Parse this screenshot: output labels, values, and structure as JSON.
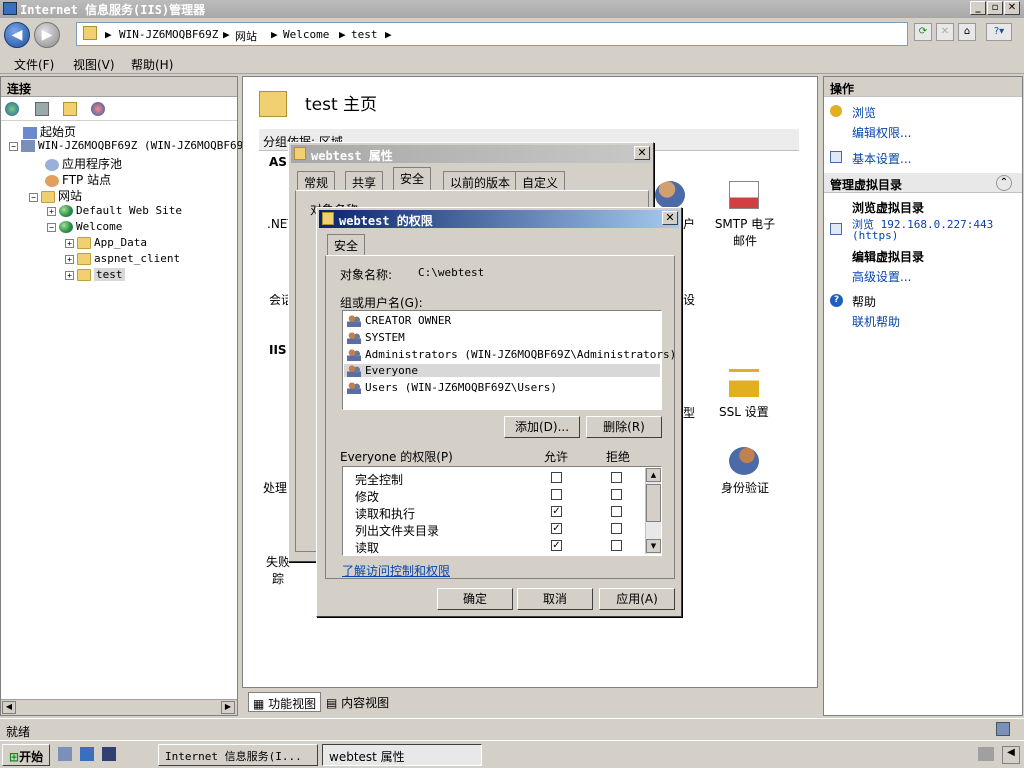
{
  "window": {
    "title": "Internet 信息服务(IIS)管理器"
  },
  "address": {
    "parts": [
      "WIN-JZ6MOQBF69Z",
      "网站",
      "Welcome",
      "test"
    ]
  },
  "menu": [
    "文件(F)",
    "视图(V)",
    "帮助(H)"
  ],
  "connections": {
    "title": "连接",
    "tree": [
      {
        "label": "起始页"
      },
      {
        "label": "WIN-JZ6MOQBF69Z (WIN-JZ6MOQBF69Z"
      },
      {
        "label": "应用程序池"
      },
      {
        "label": "FTP 站点"
      },
      {
        "label": "网站"
      },
      {
        "label": "Default Web Site"
      },
      {
        "label": "Welcome"
      },
      {
        "label": "App_Data"
      },
      {
        "label": "aspnet_client"
      },
      {
        "label": "test"
      }
    ]
  },
  "center": {
    "title": "test 主页",
    "group_label": "分组依据: 区域",
    "sections": [
      "ASP",
      "IIS"
    ],
    "features": [
      {
        "label": ".NET"
      },
      {
        "label": "会话"
      },
      {
        "label": "处理"
      },
      {
        "label": "失败 踪"
      },
      {
        "label": "户"
      },
      {
        "label": "SMTP 电子邮件"
      },
      {
        "label": "设"
      },
      {
        "label": "型"
      },
      {
        "label": "SSL 设置"
      },
      {
        "label": "身份验证"
      }
    ],
    "view_tabs": [
      "功能视图",
      "内容视图"
    ]
  },
  "actions": {
    "title": "操作",
    "browse": "浏览",
    "edit_perms": "编辑权限...",
    "basic_settings": "基本设置...",
    "manage_vdir": "管理虚拟目录",
    "browse_vdir": "浏览虚拟目录",
    "browse_addr": "浏览 192.168.0.227:443",
    "https": "(https)",
    "edit_vdir": "编辑虚拟目录",
    "advanced": "高级设置...",
    "help_title": "帮助",
    "online_help": "联机帮助"
  },
  "status": {
    "text": "就绪"
  },
  "taskbar": {
    "start": "开始",
    "items": [
      "Internet 信息服务(I...",
      "webtest 属性"
    ]
  },
  "props_dialog": {
    "title": "webtest 属性",
    "tabs": [
      "常规",
      "共享",
      "安全",
      "以前的版本",
      "自定义"
    ],
    "obj_label": "对象名称:",
    "obj_value": "C:\\webtest"
  },
  "perm_dialog": {
    "title": "webtest 的权限",
    "tab": "安全",
    "obj_label": "对象名称:",
    "obj_value": "C:\\webtest",
    "group_label": "组或用户名(G):",
    "users": [
      "CREATOR OWNER",
      "SYSTEM",
      "Administrators (WIN-JZ6MOQBF69Z\\Administrators)",
      "Everyone",
      "Users (WIN-JZ6MOQBF69Z\\Users)"
    ],
    "selected_user_index": 3,
    "add_btn": "添加(D)...",
    "remove_btn": "删除(R)",
    "perm_label": "Everyone 的权限(P)",
    "allow_col": "允许",
    "deny_col": "拒绝",
    "perms": [
      {
        "name": "完全控制",
        "allow": false,
        "deny": false
      },
      {
        "name": "修改",
        "allow": false,
        "deny": false
      },
      {
        "name": "读取和执行",
        "allow": true,
        "deny": false
      },
      {
        "name": "列出文件夹目录",
        "allow": true,
        "deny": false
      },
      {
        "name": "读取",
        "allow": true,
        "deny": false
      }
    ],
    "learn_link": "了解访问控制和权限",
    "ok": "确定",
    "cancel": "取消",
    "apply": "应用(A)"
  }
}
